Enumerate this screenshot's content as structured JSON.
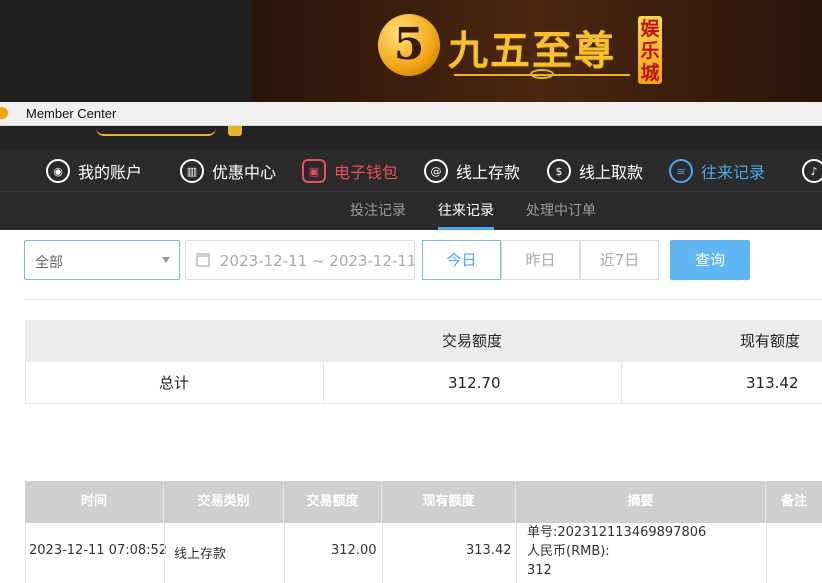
{
  "banner": {
    "logo_text": "九五至尊",
    "logo_badge": "娱乐城"
  },
  "window": {
    "title": "Member Center"
  },
  "nav": {
    "items": [
      {
        "label": "我的账户",
        "icon": "user-icon"
      },
      {
        "label": "优惠中心",
        "icon": "gift-icon"
      },
      {
        "label": "电子钱包",
        "icon": "wallet-icon"
      },
      {
        "label": "线上存款",
        "icon": "deposit-icon"
      },
      {
        "label": "线上取款",
        "icon": "withdraw-icon"
      },
      {
        "label": "往来记录",
        "icon": "record-icon"
      },
      {
        "label": "",
        "icon": "bell-icon"
      }
    ]
  },
  "subnav": {
    "items": [
      "投注记录",
      "往来记录",
      "处理中订单"
    ],
    "active_index": 1
  },
  "filters": {
    "type_select": "全部",
    "date_range": "2023-12-11 ~ 2023-12-11",
    "quick": [
      "今日",
      "昨日",
      "近7日"
    ],
    "active_quick": 0,
    "search_label": "查询"
  },
  "summary": {
    "headers": [
      "交易额度",
      "现有额度"
    ],
    "row_label": "总计",
    "trade_amount": "312.70",
    "balance": "313.42"
  },
  "detail": {
    "headers": [
      "时间",
      "交易类别",
      "交易额度",
      "现有额度",
      "摘要",
      "备注"
    ],
    "rows": [
      {
        "time": "2023-12-11 07:08:52",
        "type": "线上存款",
        "amount": "312.00",
        "balance": "313.42",
        "memo": [
          "单号:202312113469897806",
          "人民币(RMB):",
          "312"
        ],
        "note": ""
      }
    ]
  },
  "colors": {
    "accent_blue": "#4aa8f0",
    "active_red": "#e8505b",
    "nav_bg": "#2b2b2b",
    "gold": "#f6c02e"
  }
}
